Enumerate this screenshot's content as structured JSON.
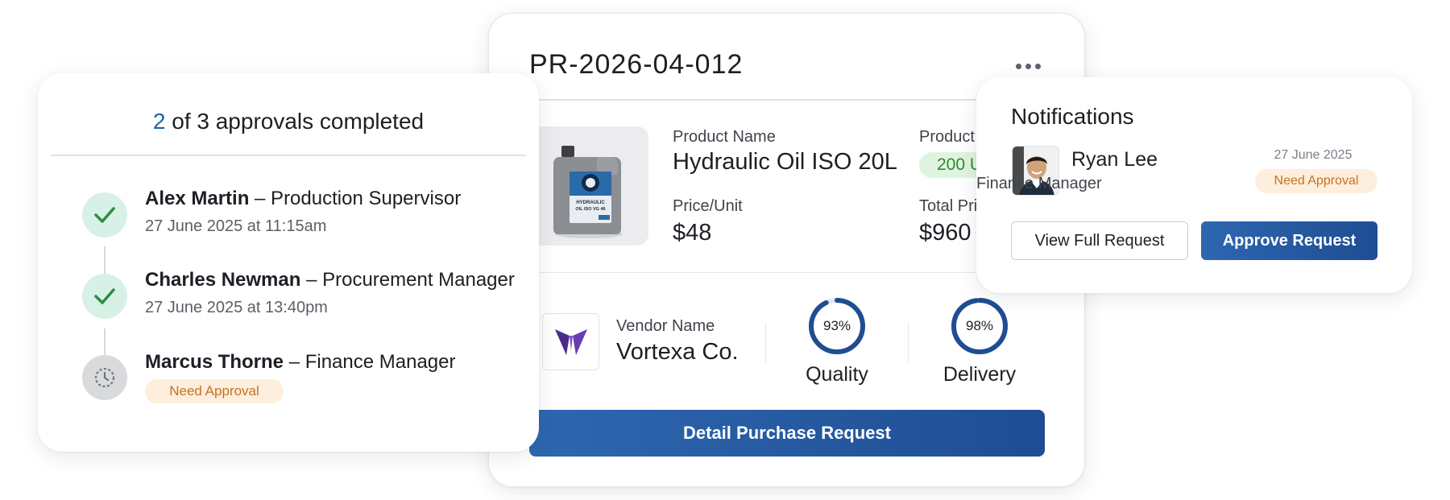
{
  "purchase_request": {
    "id": "PR-2026-04-012",
    "product_name_label": "Product Name",
    "product_name": "Hydraulic Oil ISO 20L",
    "product_qty_label": "Product I",
    "product_qty": "200 Ur",
    "price_label": "Price/Unit",
    "price": "$48",
    "total_label": "Total Pric",
    "total": "$960",
    "product_image_text": [
      "HYDRAULIC",
      "OIL ISO VG 46"
    ],
    "vendor_label": "Vendor Name",
    "vendor_name": "Vortexa Co.",
    "metrics": [
      {
        "label": "Quality",
        "value": 93,
        "display": "93%"
      },
      {
        "label": "Delivery",
        "value": 98,
        "display": "98%"
      }
    ],
    "detail_button": "Detail Purchase Request"
  },
  "approvals": {
    "completed": "2",
    "title_rest": " of 3 approvals completed",
    "steps": [
      {
        "name": "Alex Martin",
        "role": " – Production Supervisor",
        "time": "27 June  2025 at 11:15am",
        "status": "done"
      },
      {
        "name": "Charles Newman",
        "role": " – Procurement Manager",
        "time": "27 June  2025 at 13:40pm",
        "status": "done"
      },
      {
        "name": "Marcus Thorne",
        "role": " – Finance Manager",
        "badge": "Need Approval",
        "status": "pending"
      }
    ]
  },
  "notifications": {
    "title": "Notifications",
    "name": "Ryan Lee",
    "role": "Finance Manager",
    "date": "27 June 2025",
    "badge": "Need Approval",
    "view_button": "View Full Request",
    "approve_button": "Approve Request"
  },
  "colors": {
    "primary": "#2a5ea8",
    "success_bg": "#d8f1e6",
    "success_icon": "#2f8a45",
    "warning_bg": "#fdeede",
    "warning_text": "#c4741d",
    "ring": "#1f4d93"
  }
}
